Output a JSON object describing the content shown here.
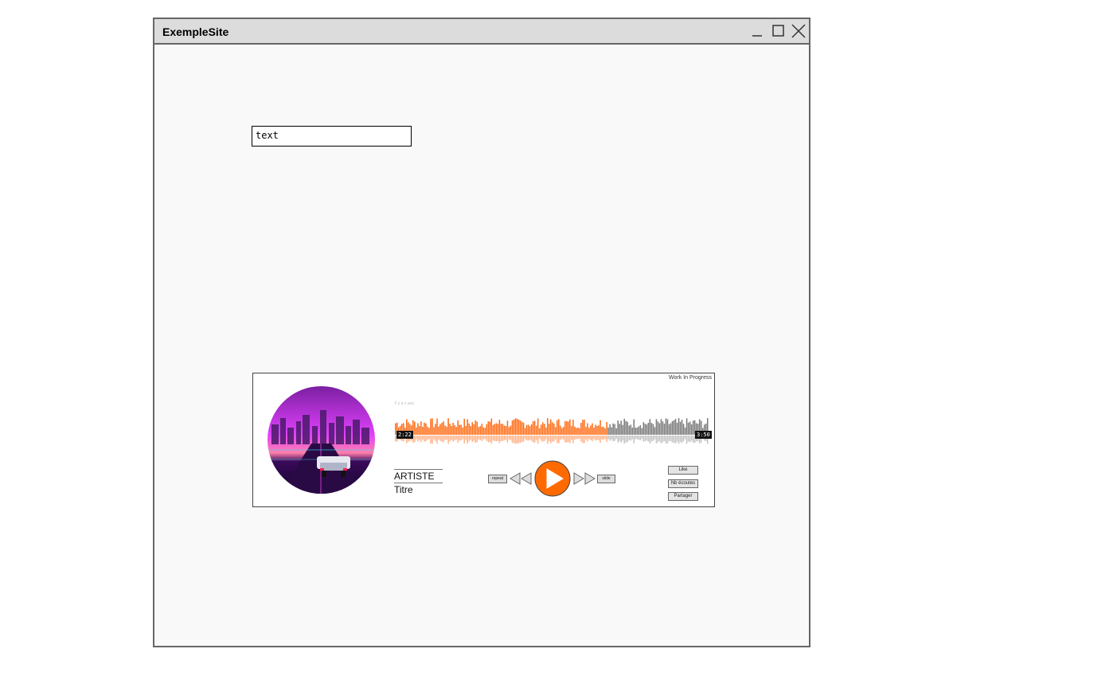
{
  "window": {
    "title": "ExempleSite"
  },
  "search": {
    "value": "text"
  },
  "player": {
    "status_label": "Work In Progress",
    "faint_text": "Il y a x ans",
    "artist": "ARTISTE",
    "track_title": "Titre",
    "time_elapsed": "2:22",
    "time_total": "3:50",
    "progress_fraction": 0.68,
    "repeat_label": "repeat",
    "slide_label": "slide",
    "like_label": "Like",
    "listens_label": "Nb écoutes",
    "share_label": "Partager",
    "colors": {
      "played": "#ff6a13",
      "unplayed": "#7a7a7a",
      "play_button": "#ff6a00"
    }
  }
}
